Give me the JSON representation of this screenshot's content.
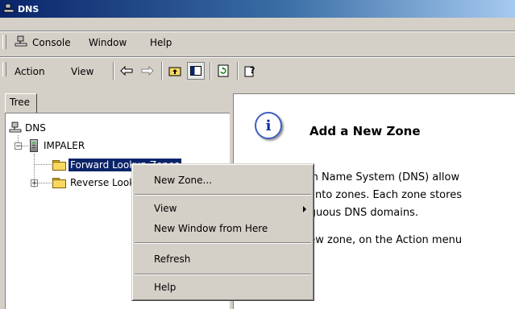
{
  "window": {
    "title": "DNS"
  },
  "menubar": {
    "console": "Console",
    "window": "Window",
    "help": "Help"
  },
  "toolbar": {
    "action": "Action",
    "view": "View"
  },
  "tree": {
    "tab_label": "Tree",
    "root": "DNS",
    "server": "IMPALER",
    "forward": "Forward Lookup Zones",
    "reverse": "Reverse Lookup Zones"
  },
  "details": {
    "heading": "Add a New Zone",
    "line1": "ain Name System (DNS) allow",
    "line2": "p into zones. Each zone stores",
    "line3": "tiguous DNS domains.",
    "line4": "new zone, on the Action menu"
  },
  "context_menu": {
    "new_zone": "New Zone...",
    "view": "View",
    "new_window": "New Window from Here",
    "refresh": "Refresh",
    "help": "Help"
  }
}
